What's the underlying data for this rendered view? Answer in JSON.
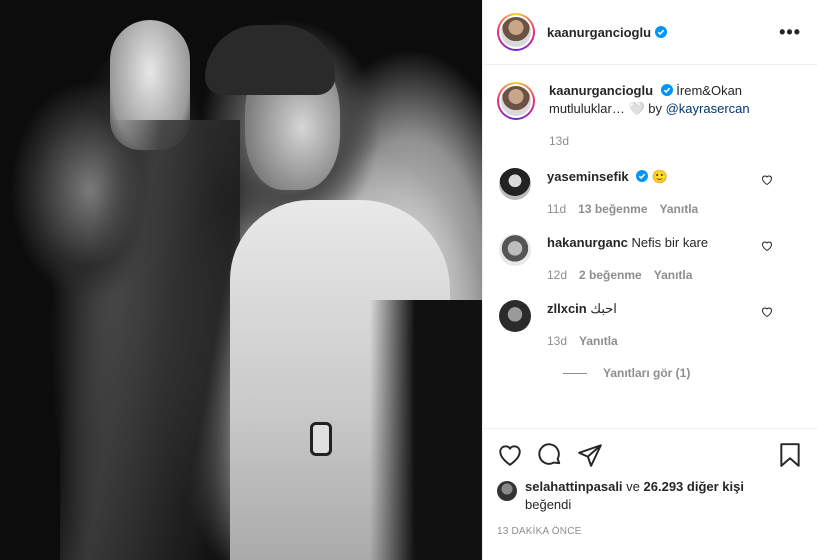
{
  "post": {
    "username": "kaanurgancioglu",
    "more_label": "•••"
  },
  "caption": {
    "username": "kaanurgancioglu",
    "text": "İrem&Okan mutluluklar… 🤍 by ",
    "mention": "@kayrasercan",
    "time": "13d"
  },
  "comments": [
    {
      "username": "yaseminsefik",
      "verified": true,
      "text": "🙂",
      "time": "11d",
      "likes": "13 beğenme",
      "reply": "Yanıtla"
    },
    {
      "username": "hakanurganc",
      "verified": false,
      "text": "Nefis bir kare",
      "time": "12d",
      "likes": "2 beğenme",
      "reply": "Yanıtla"
    },
    {
      "username": "zllxcin",
      "verified": false,
      "text": "احبك",
      "time": "13d",
      "likes": "",
      "reply": "Yanıtla"
    }
  ],
  "view_replies": "Yanıtları gör (1)",
  "likes": {
    "user": "selahattinpasali",
    "connector": " ve ",
    "count": "26.293 diğer kişi",
    "suffix": "beğendi"
  },
  "time_ago": "13 DAKİKA ÖNCE",
  "icons": {
    "like": "heart-icon",
    "comment": "comment-icon",
    "share": "share-icon",
    "save": "bookmark-icon",
    "verified": "verified-badge-icon"
  },
  "colors": {
    "verified": "#0095f6",
    "link": "#00376b",
    "muted": "#8e8e8e"
  }
}
